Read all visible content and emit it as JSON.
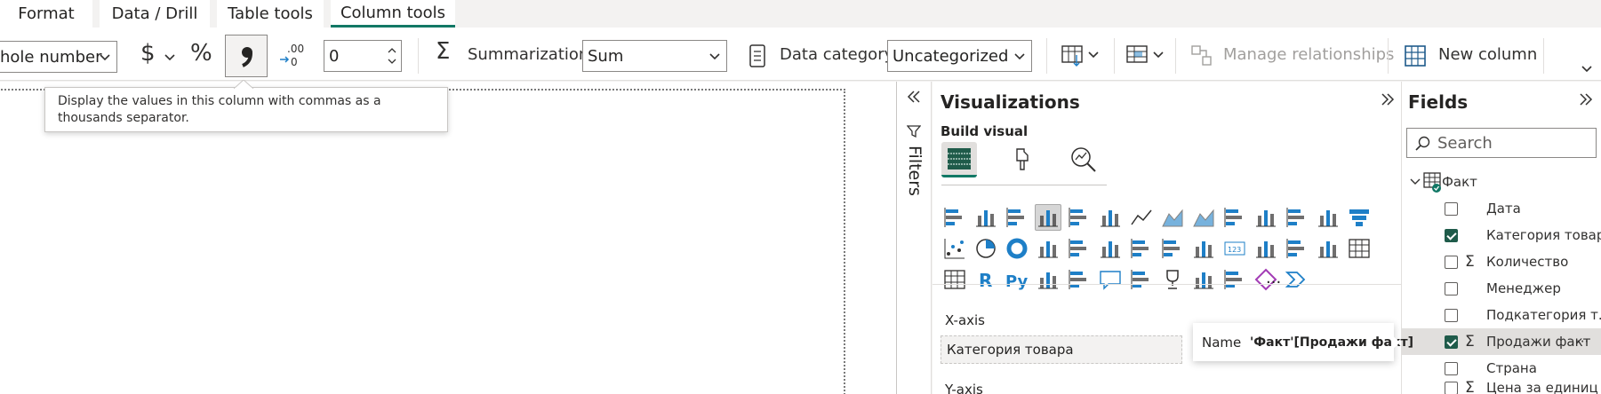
{
  "tabs": [
    {
      "label": "Format"
    },
    {
      "label": "Data / Drill"
    },
    {
      "label": "Table tools"
    },
    {
      "label": "Column tools"
    }
  ],
  "ribbon": {
    "format_value": "hole number",
    "currency_symbol": "$",
    "percent_symbol": "%",
    "comma_symbol": "❟",
    "decimal_value": "0",
    "summarization_label": "Summarization",
    "summarization_value": "Sum",
    "data_category_label": "Data category",
    "data_category_value": "Uncategorized",
    "manage_relationships_label": "Manage relationships",
    "new_column_label": "New column",
    "sigma_symbol": "Σ"
  },
  "tooltip": {
    "text": "Display the values in this column with commas as a thousands separator."
  },
  "filters": {
    "label": "Filters"
  },
  "visualizations": {
    "title": "Visualizations",
    "build_visual_label": "Build visual",
    "more_label": "···",
    "r_label": "R",
    "py_label": "Py",
    "x_axis_label": "X-axis",
    "x_axis_value": "Категория товара",
    "y_axis_label": "Y-axis"
  },
  "fields": {
    "title": "Fields",
    "search_placeholder": "Search",
    "table_name": "Факт",
    "items": [
      {
        "label": "Дата",
        "checked": false,
        "sigma": false
      },
      {
        "label": "Категория товара",
        "checked": true,
        "sigma": false
      },
      {
        "label": "Количество",
        "checked": false,
        "sigma": true
      },
      {
        "label": "Менеджер",
        "checked": false,
        "sigma": false
      },
      {
        "label": "Подкатегория т...",
        "checked": false,
        "sigma": false
      },
      {
        "label": "Продажи факт",
        "checked": true,
        "sigma": true
      },
      {
        "label": "Страна",
        "checked": false,
        "sigma": false
      },
      {
        "label": "Цена за единиц",
        "checked": false,
        "sigma": true
      }
    ],
    "more_label": "···"
  },
  "name_popup": {
    "label": "Name",
    "value": "'Факт'[Продажи факт]"
  },
  "colors": {
    "accent": "#117865",
    "checkbox": "#1f5b4a",
    "icon_blue": "#1e7fc7",
    "icon_teal": "#118dff"
  }
}
